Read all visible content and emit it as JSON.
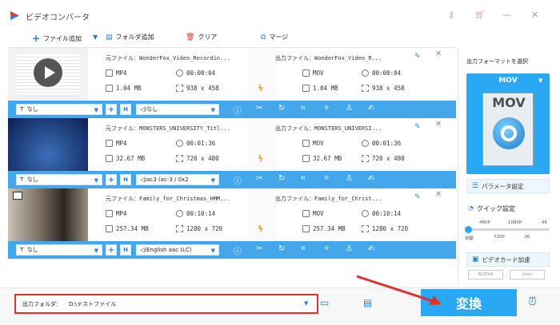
{
  "window": {
    "title": "ビデオコンバータ"
  },
  "toolbar": {
    "add_file": "ファイル追加",
    "add_folder": "フォルダ追加",
    "clear": "クリア",
    "merge": "マージ"
  },
  "files": [
    {
      "source": "元ファイル：WonderFox_Video_Recordin...",
      "output": "出力ファイル：WonderFox_Video_R...",
      "src_format": "MP4",
      "src_duration": "00:00:04",
      "src_size": "1.04 MB",
      "src_res": "938 x 458",
      "out_format": "MOV",
      "out_duration": "00:00:04",
      "out_size": "1.04 MB",
      "out_res": "938 x 458",
      "subtitle": "なし",
      "audio": "なし"
    },
    {
      "source": "元ファイル：MONSTERS_UNIVERSITY_Titl...",
      "output": "出力ファイル：MONSTERS_UNIVERSI...",
      "src_format": "MP4",
      "src_duration": "00:01:36",
      "src_size": "32.67 MB",
      "src_res": "720 x 480",
      "out_format": "MOV",
      "out_duration": "00:01:36",
      "out_size": "32.67 MB",
      "out_res": "720 x 480",
      "subtitle": "なし",
      "audio": "ac3 (ac-3 / 0x2"
    },
    {
      "source": "元ファイル：Family_for_Christmas_HMM...",
      "output": "出力ファイル：Family_for_Christ...",
      "src_format": "MP4",
      "src_duration": "00:10:14",
      "src_size": "257.34 MB",
      "src_res": "1280 x 720",
      "out_format": "MOV",
      "out_duration": "00:10:14",
      "out_size": "257.34 MB",
      "out_res": "1280 x 720",
      "subtitle": "なし",
      "audio": "English aac (LC)"
    }
  ],
  "right_panel": {
    "heading": "出力フォーマットを選択",
    "format": "MOV",
    "format_logo_text": "MOV",
    "params": "パラメータ設定",
    "quick": "クイック設定",
    "ticks_top": [
      "480P",
      "1080P",
      "4K"
    ],
    "ticks_bottom": [
      "自動",
      "720P",
      "2K"
    ],
    "gpu": "ビデオカード加速",
    "nvidia": "NVIDIA",
    "intel": "Intel"
  },
  "bottom": {
    "folder_label": "出力フォルダ：",
    "folder_path": "D:\\テストファイル",
    "convert": "変換"
  },
  "colors": {
    "accent": "#2aa8f2",
    "highlight": "#e0302f",
    "bolt": "#f39a2f"
  }
}
